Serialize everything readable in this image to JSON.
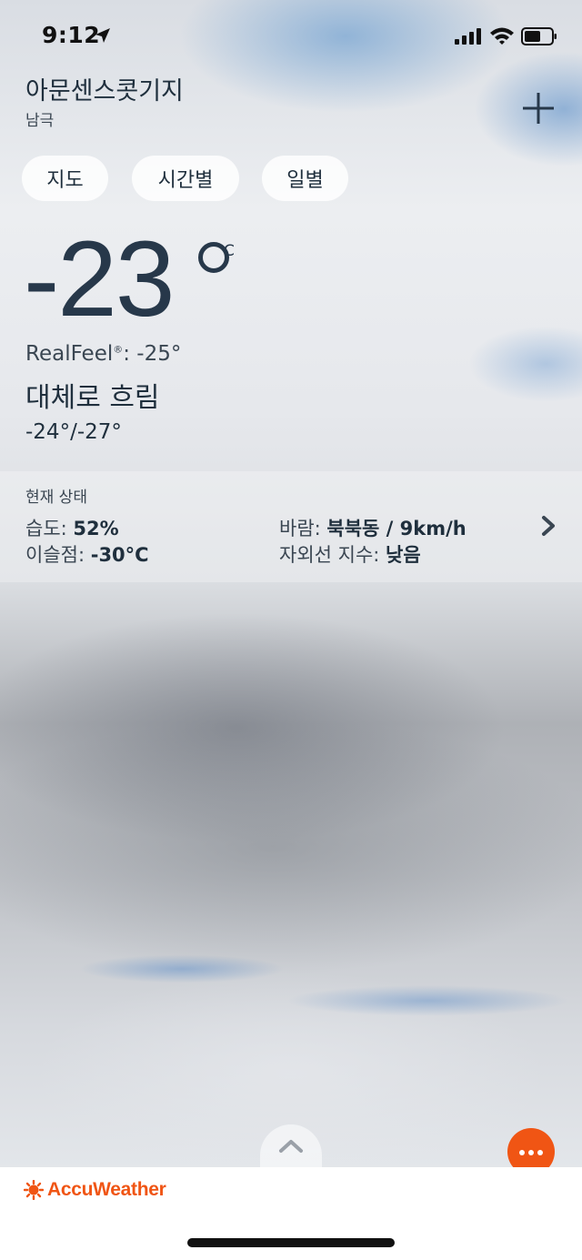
{
  "status_bar": {
    "time": "9:12"
  },
  "header": {
    "city": "아문센스콧기지",
    "region": "남극"
  },
  "tabs": [
    {
      "label": "지도"
    },
    {
      "label": "시간별"
    },
    {
      "label": "일별"
    }
  ],
  "current": {
    "temp": "-23",
    "unit": "C",
    "realfeel_label": "RealFeel",
    "realfeel_mark": "®",
    "realfeel_value": ": -25°",
    "condition": "대체로 흐림",
    "hilo": "-24°/-27°"
  },
  "conditions": {
    "title": "현재 상태",
    "humidity_label": "습도:",
    "humidity_value": "52%",
    "dewpoint_label": "이슬점:",
    "dewpoint_value": "-30°C",
    "wind_label": "바람:",
    "wind_value": "북북동 / 9km/h",
    "uv_label": "자외선 지수:",
    "uv_value": "낮음"
  },
  "footer": {
    "brand": "AccuWeather"
  },
  "colors": {
    "accent": "#f05514",
    "text": "#1f2f3d"
  },
  "icons": [
    "location-arrow-icon",
    "signal-icon",
    "wifi-icon",
    "battery-icon",
    "plus-icon",
    "chevron-right-icon",
    "chevron-up-icon",
    "more-icon",
    "accuweather-sun-icon"
  ]
}
